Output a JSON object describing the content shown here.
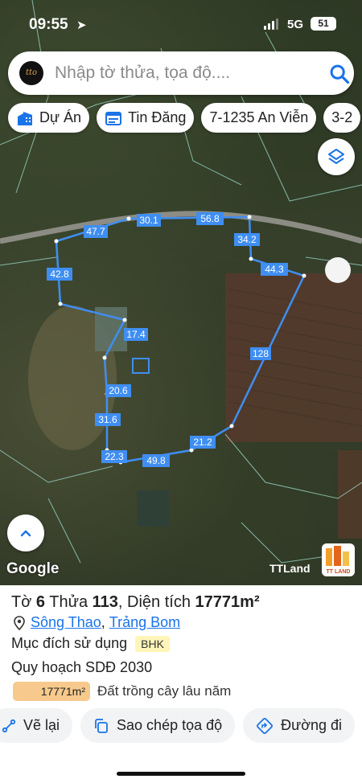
{
  "status": {
    "time": "09:55",
    "network": "5G",
    "battery": "51"
  },
  "search": {
    "placeholder": "Nhập tờ thửa, tọa độ....",
    "logo_text": "tto"
  },
  "chips": [
    {
      "label": "Dự Án",
      "icon": "project-icon"
    },
    {
      "label": "Tin Đăng",
      "icon": "listing-icon"
    },
    {
      "label": "7-1235 An Viễn",
      "icon": null
    },
    {
      "label": "3-2",
      "icon": null
    }
  ],
  "map": {
    "edge_labels": [
      "30.1",
      "56.8",
      "47.7",
      "34.2",
      "42.8",
      "44.3",
      "17.4",
      "128",
      "20.6",
      "31.6",
      "21.2",
      "22.3",
      "49.8"
    ],
    "attribution": "Google",
    "brand": "TTLand",
    "badge_text": "TT LAND",
    "boundary_color": "#3f8ef2"
  },
  "parcel": {
    "to_label": "Tờ",
    "to": "6",
    "thua_label": "Thửa",
    "thua": "113",
    "area_label": "Diện tích",
    "area": "17771m²",
    "commune": "Sông Thao",
    "district": "Trảng Bom",
    "purpose_label": "Mục đích sử dụng",
    "purpose_code": "BHK",
    "planning_label": "Quy hoạch SDĐ 2030",
    "planning_area": "17771m²",
    "planning_type": "Đất trồng cây lâu năm",
    "planning_color": "#f7c98c"
  },
  "actions": [
    {
      "label": "Vẽ lại"
    },
    {
      "label": "Sao chép tọa độ"
    },
    {
      "label": "Đường đi"
    }
  ]
}
